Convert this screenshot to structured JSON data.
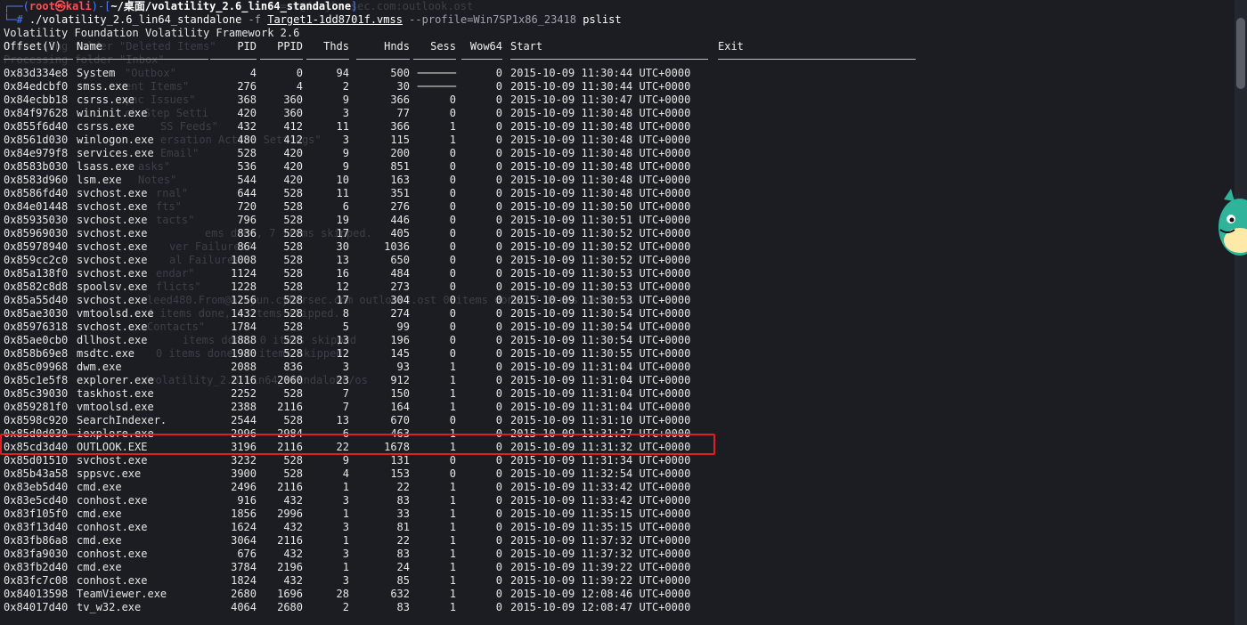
{
  "prompt": {
    "box": "┌──(",
    "user": "root㉿kali",
    "sep": ")-[",
    "path": "~/桌面/volatility_2.6_lin64_standalone",
    "end": "]"
  },
  "command": {
    "hash": "└─# ",
    "exe": "./volatility_2.6_lin64_standalone",
    "flag_f": " -f ",
    "file": "Target1-1dd8701f.vmss",
    "profile": " --profile=Win7SP1x86_23418",
    "plugin": " pslist"
  },
  "banner": "Volatility Foundation Volatility Framework 2.6",
  "ghost_text": [
    "fo=rk@ffcybersec.com:outlook.ost",
    "Processing folder \"Deleted Items\"",
    "Processing folder \"Inbox\"",
    "\"Outbox\"",
    "ent Items\"",
    "ync Issues\"",
    "ck Step Setti",
    "SS Feeds\"",
    "ersation Action Settings\"",
    "Email\"",
    "asks\"",
    "Notes\"",
    "rnal\"",
    "fts\"",
    "tacts\"",
    "ems done, 7 items skipped.",
    "ver Failures\"",
    "al Failures\"",
    "endar\"",
    "flicts\"",
    "leed480.From@aliyun.cybersec.com outlook2.ost 0 items done, 7 items skipped.",
    "4 items done, 0 items skipped.",
    "Contacts\"",
    "items done, 0 items skipped",
    "0 items done, 0 items skipped",
    "/volatility_2.6_lin64_standalone/os"
  ],
  "table": {
    "headers": [
      "Offset(V)",
      "Name",
      "PID",
      "PPID",
      "Thds",
      "Hnds",
      "Sess",
      "Wow64",
      "Start",
      "Exit"
    ],
    "rows": [
      [
        "0x83d334e8",
        "System",
        "4",
        "0",
        "94",
        "500",
        "──────",
        "0",
        "2015-10-09 11:30:44 UTC+0000",
        ""
      ],
      [
        "0x84edcbf0",
        "smss.exe",
        "276",
        "4",
        "2",
        "30",
        "──────",
        "0",
        "2015-10-09 11:30:44 UTC+0000",
        ""
      ],
      [
        "0x84ecbb18",
        "csrss.exe",
        "368",
        "360",
        "9",
        "366",
        "0",
        "0",
        "2015-10-09 11:30:47 UTC+0000",
        ""
      ],
      [
        "0x84f97628",
        "wininit.exe",
        "420",
        "360",
        "3",
        "77",
        "0",
        "0",
        "2015-10-09 11:30:48 UTC+0000",
        ""
      ],
      [
        "0x855f6d40",
        "csrss.exe",
        "432",
        "412",
        "11",
        "366",
        "1",
        "0",
        "2015-10-09 11:30:48 UTC+0000",
        ""
      ],
      [
        "0x8561d030",
        "winlogon.exe",
        "480",
        "412",
        "3",
        "115",
        "1",
        "0",
        "2015-10-09 11:30:48 UTC+0000",
        ""
      ],
      [
        "0x84e979f8",
        "services.exe",
        "528",
        "420",
        "9",
        "200",
        "0",
        "0",
        "2015-10-09 11:30:48 UTC+0000",
        ""
      ],
      [
        "0x8583b030",
        "lsass.exe",
        "536",
        "420",
        "9",
        "851",
        "0",
        "0",
        "2015-10-09 11:30:48 UTC+0000",
        ""
      ],
      [
        "0x8583d960",
        "lsm.exe",
        "544",
        "420",
        "10",
        "163",
        "0",
        "0",
        "2015-10-09 11:30:48 UTC+0000",
        ""
      ],
      [
        "0x8586fd40",
        "svchost.exe",
        "644",
        "528",
        "11",
        "351",
        "0",
        "0",
        "2015-10-09 11:30:48 UTC+0000",
        ""
      ],
      [
        "0x84e01448",
        "svchost.exe",
        "720",
        "528",
        "6",
        "276",
        "0",
        "0",
        "2015-10-09 11:30:50 UTC+0000",
        ""
      ],
      [
        "0x85935030",
        "svchost.exe",
        "796",
        "528",
        "19",
        "446",
        "0",
        "0",
        "2015-10-09 11:30:51 UTC+0000",
        ""
      ],
      [
        "0x85969030",
        "svchost.exe",
        "836",
        "528",
        "17",
        "405",
        "0",
        "0",
        "2015-10-09 11:30:52 UTC+0000",
        ""
      ],
      [
        "0x85978940",
        "svchost.exe",
        "864",
        "528",
        "30",
        "1036",
        "0",
        "0",
        "2015-10-09 11:30:52 UTC+0000",
        ""
      ],
      [
        "0x859cc2c0",
        "svchost.exe",
        "1008",
        "528",
        "13",
        "650",
        "0",
        "0",
        "2015-10-09 11:30:52 UTC+0000",
        ""
      ],
      [
        "0x85a138f0",
        "svchost.exe",
        "1124",
        "528",
        "16",
        "484",
        "0",
        "0",
        "2015-10-09 11:30:53 UTC+0000",
        ""
      ],
      [
        "0x8582c8d8",
        "spoolsv.exe",
        "1228",
        "528",
        "12",
        "273",
        "0",
        "0",
        "2015-10-09 11:30:53 UTC+0000",
        ""
      ],
      [
        "0x85a55d40",
        "svchost.exe",
        "1256",
        "528",
        "17",
        "304",
        "0",
        "0",
        "2015-10-09 11:30:53 UTC+0000",
        ""
      ],
      [
        "0x85ae3030",
        "vmtoolsd.exe",
        "1432",
        "528",
        "8",
        "274",
        "0",
        "0",
        "2015-10-09 11:30:54 UTC+0000",
        ""
      ],
      [
        "0x85976318",
        "svchost.exe",
        "1784",
        "528",
        "5",
        "99",
        "0",
        "0",
        "2015-10-09 11:30:54 UTC+0000",
        ""
      ],
      [
        "0x85ae0cb0",
        "dllhost.exe",
        "1888",
        "528",
        "13",
        "196",
        "0",
        "0",
        "2015-10-09 11:30:54 UTC+0000",
        ""
      ],
      [
        "0x858b69e8",
        "msdtc.exe",
        "1980",
        "528",
        "12",
        "145",
        "0",
        "0",
        "2015-10-09 11:30:55 UTC+0000",
        ""
      ],
      [
        "0x85c09968",
        "dwm.exe",
        "2088",
        "836",
        "3",
        "93",
        "1",
        "0",
        "2015-10-09 11:31:04 UTC+0000",
        ""
      ],
      [
        "0x85c1e5f8",
        "explorer.exe",
        "2116",
        "2060",
        "23",
        "912",
        "1",
        "0",
        "2015-10-09 11:31:04 UTC+0000",
        ""
      ],
      [
        "0x85c39030",
        "taskhost.exe",
        "2252",
        "528",
        "7",
        "150",
        "1",
        "0",
        "2015-10-09 11:31:04 UTC+0000",
        ""
      ],
      [
        "0x859281f0",
        "vmtoolsd.exe",
        "2388",
        "2116",
        "7",
        "164",
        "1",
        "0",
        "2015-10-09 11:31:04 UTC+0000",
        ""
      ],
      [
        "0x8598c920",
        "SearchIndexer.",
        "2544",
        "528",
        "13",
        "670",
        "0",
        "0",
        "2015-10-09 11:31:10 UTC+0000",
        ""
      ],
      [
        "0x85d0d030",
        "iexplore.exe",
        "2996",
        "2984",
        "6",
        "463",
        "1",
        "0",
        "2015-10-09 11:31:27 UTC+0000",
        ""
      ],
      [
        "0x85cd3d40",
        "OUTLOOK.EXE",
        "3196",
        "2116",
        "22",
        "1678",
        "1",
        "0",
        "2015-10-09 11:31:32 UTC+0000",
        ""
      ],
      [
        "0x85d01510",
        "svchost.exe",
        "3232",
        "528",
        "9",
        "131",
        "0",
        "0",
        "2015-10-09 11:31:34 UTC+0000",
        ""
      ],
      [
        "0x85b43a58",
        "sppsvc.exe",
        "3900",
        "528",
        "4",
        "153",
        "0",
        "0",
        "2015-10-09 11:32:54 UTC+0000",
        ""
      ],
      [
        "0x83eb5d40",
        "cmd.exe",
        "2496",
        "2116",
        "1",
        "22",
        "1",
        "0",
        "2015-10-09 11:33:42 UTC+0000",
        ""
      ],
      [
        "0x83e5cd40",
        "conhost.exe",
        "916",
        "432",
        "3",
        "83",
        "1",
        "0",
        "2015-10-09 11:33:42 UTC+0000",
        ""
      ],
      [
        "0x83f105f0",
        "cmd.exe",
        "1856",
        "2996",
        "1",
        "33",
        "1",
        "0",
        "2015-10-09 11:35:15 UTC+0000",
        ""
      ],
      [
        "0x83f13d40",
        "conhost.exe",
        "1624",
        "432",
        "3",
        "81",
        "1",
        "0",
        "2015-10-09 11:35:15 UTC+0000",
        ""
      ],
      [
        "0x83fb86a8",
        "cmd.exe",
        "3064",
        "2116",
        "1",
        "22",
        "1",
        "0",
        "2015-10-09 11:37:32 UTC+0000",
        ""
      ],
      [
        "0x83fa9030",
        "conhost.exe",
        "676",
        "432",
        "3",
        "83",
        "1",
        "0",
        "2015-10-09 11:37:32 UTC+0000",
        ""
      ],
      [
        "0x83fb2d40",
        "cmd.exe",
        "3784",
        "2196",
        "1",
        "24",
        "1",
        "0",
        "2015-10-09 11:39:22 UTC+0000",
        ""
      ],
      [
        "0x83fc7c08",
        "conhost.exe",
        "1824",
        "432",
        "3",
        "85",
        "1",
        "0",
        "2015-10-09 11:39:22 UTC+0000",
        ""
      ],
      [
        "0x84013598",
        "TeamViewer.exe",
        "2680",
        "1696",
        "28",
        "632",
        "1",
        "0",
        "2015-10-09 12:08:46 UTC+0000",
        ""
      ],
      [
        "0x84017d40",
        "tv_w32.exe",
        "4064",
        "2680",
        "2",
        "83",
        "1",
        "0",
        "2015-10-09 12:08:47 UTC+0000",
        ""
      ]
    ],
    "highlighted_row_index": 28
  },
  "colors": {
    "background": "#1b1d23",
    "text": "#e6e6e6",
    "prompt_blue": "#4f7cff",
    "prompt_user_red": "#ff4f4f",
    "highlight_red": "#e02020"
  }
}
